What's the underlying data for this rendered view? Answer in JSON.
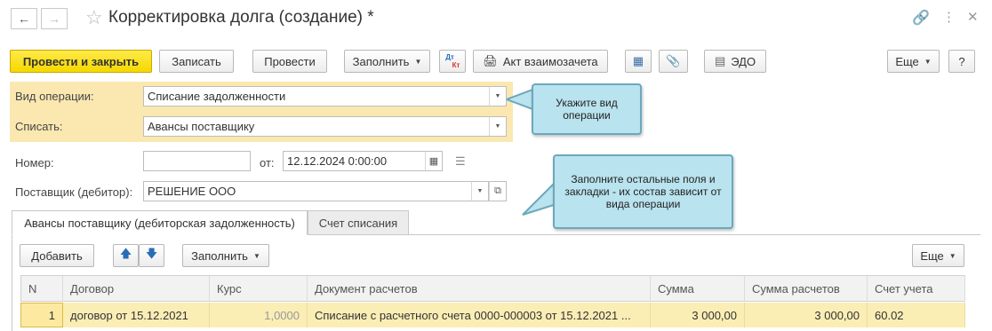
{
  "window": {
    "title": "Корректировка долга (создание) *"
  },
  "toolbar": {
    "post_close": "Провести и закрыть",
    "save": "Записать",
    "post": "Провести",
    "fill": "Заполнить",
    "dt_kt_top": "Дт",
    "dt_kt_bottom": "Кт",
    "act": "Акт взаимозачета",
    "edo": "ЭДО",
    "more": "Еще",
    "help": "?"
  },
  "form": {
    "operation_label": "Вид операции:",
    "operation_value": "Списание задолженности",
    "writeoff_label": "Списать:",
    "writeoff_value": "Авансы поставщику",
    "number_label": "Номер:",
    "number_value": "",
    "date_label": "от:",
    "date_value": "12.12.2024  0:00:00",
    "supplier_label": "Поставщик (дебитор):",
    "supplier_value": "РЕШЕНИЕ ООО"
  },
  "tips": {
    "tip1": "Укажите вид операции",
    "tip2": "Заполните остальные поля и закладки - их состав зависит от вида операции"
  },
  "tabs": [
    {
      "label": "Авансы поставщику (дебиторская задолженность)",
      "active": true
    },
    {
      "label": "Счет списания",
      "active": false
    }
  ],
  "table_toolbar": {
    "add": "Добавить",
    "fill": "Заполнить",
    "more": "Еще"
  },
  "table": {
    "columns": [
      "N",
      "Договор",
      "Курс",
      "Документ расчетов",
      "Сумма",
      "Сумма расчетов",
      "Счет учета"
    ],
    "rows": [
      [
        "1",
        "договор от 15.12.2021",
        "1,0000",
        "Списание с расчетного счета 0000-000003 от 15.12.2021 ...",
        "3 000,00",
        "3 000,00",
        "60.02"
      ]
    ]
  },
  "colors": {
    "primary_button": "#f5d800",
    "highlight_area": "#fbe8b1",
    "tooltip_bg": "#b9e3ee",
    "selected_row": "#fbeeb5"
  }
}
